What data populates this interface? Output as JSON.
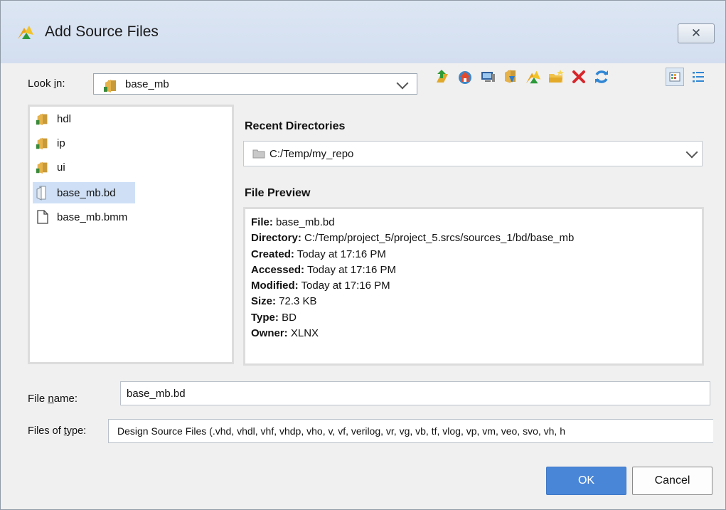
{
  "window": {
    "title": "Add Source Files",
    "close_glyph": "✕"
  },
  "look_in": {
    "label_pre": "Look ",
    "label_ul": "i",
    "label_post": "n:",
    "value": "base_mb",
    "toolbar": [
      "up-folder-icon",
      "home-icon",
      "desktop-icon",
      "bookmark-folder-icon",
      "vivado-logo-icon",
      "new-folder-icon",
      "delete-icon",
      "refresh-icon",
      "icon-view-icon",
      "details-view-icon"
    ]
  },
  "files": [
    {
      "name": "hdl",
      "icon": "folder-icon",
      "selected": false
    },
    {
      "name": "ip",
      "icon": "folder-icon",
      "selected": false
    },
    {
      "name": "ui",
      "icon": "folder-icon",
      "selected": false
    },
    {
      "name": "base_mb.bd",
      "icon": "bd-file-icon",
      "selected": true
    },
    {
      "name": "base_mb.bmm",
      "icon": "document-icon",
      "selected": false
    }
  ],
  "recent": {
    "title": "Recent Directories",
    "value": "C:/Temp/my_repo"
  },
  "preview": {
    "title": "File Preview",
    "rows": [
      {
        "key": "File:",
        "val": " base_mb.bd"
      },
      {
        "key": "Directory:",
        "val": " C:/Temp/project_5/project_5.srcs/sources_1/bd/base_mb"
      },
      {
        "key": "Created:",
        "val": " Today at 17:16 PM"
      },
      {
        "key": "Accessed:",
        "val": " Today at 17:16 PM"
      },
      {
        "key": "Modified:",
        "val": " Today at 17:16 PM"
      },
      {
        "key": "Size:",
        "val": " 72.3 KB"
      },
      {
        "key": "Type:",
        "val": " BD"
      },
      {
        "key": "Owner:",
        "val": " XLNX"
      }
    ]
  },
  "file_name": {
    "label_pre": "File ",
    "label_ul": "n",
    "label_post": "ame:",
    "value": "base_mb.bd"
  },
  "file_type": {
    "label_pre": "Files of ",
    "label_ul": "t",
    "label_post": "ype:",
    "value": "Design Source Files (.vhd, vhdl, vhf, vhdp, vho, v, vf, verilog, vr, vg, vb, tf, vlog, vp, vm, veo, svo, vh, h"
  },
  "buttons": {
    "ok": "OK",
    "cancel": "Cancel"
  },
  "colors": {
    "accent": "#4a86d8",
    "title_bar": "#d3def0",
    "selection": "#cfe0f6"
  }
}
